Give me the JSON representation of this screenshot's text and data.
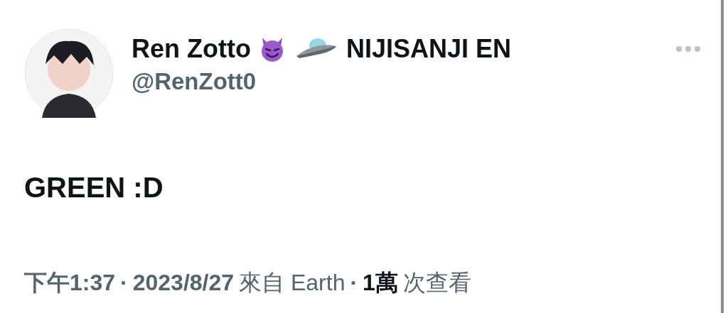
{
  "author": {
    "display_name": "Ren Zotto",
    "affiliation": "NIJISANJI EN",
    "handle": "@RenZott0"
  },
  "tweet": {
    "text": "GREEN :D"
  },
  "meta": [
    {
      "kind": "time",
      "text": "下午1:37"
    },
    {
      "kind": "sep",
      "text": "·"
    },
    {
      "kind": "text",
      "text": "2023/8/27"
    },
    {
      "kind": "plain",
      "text": "來自 Earth"
    },
    {
      "kind": "sep",
      "text": "·"
    },
    {
      "kind": "count",
      "text": "1萬"
    },
    {
      "kind": "plain",
      "text": "次查看"
    }
  ]
}
